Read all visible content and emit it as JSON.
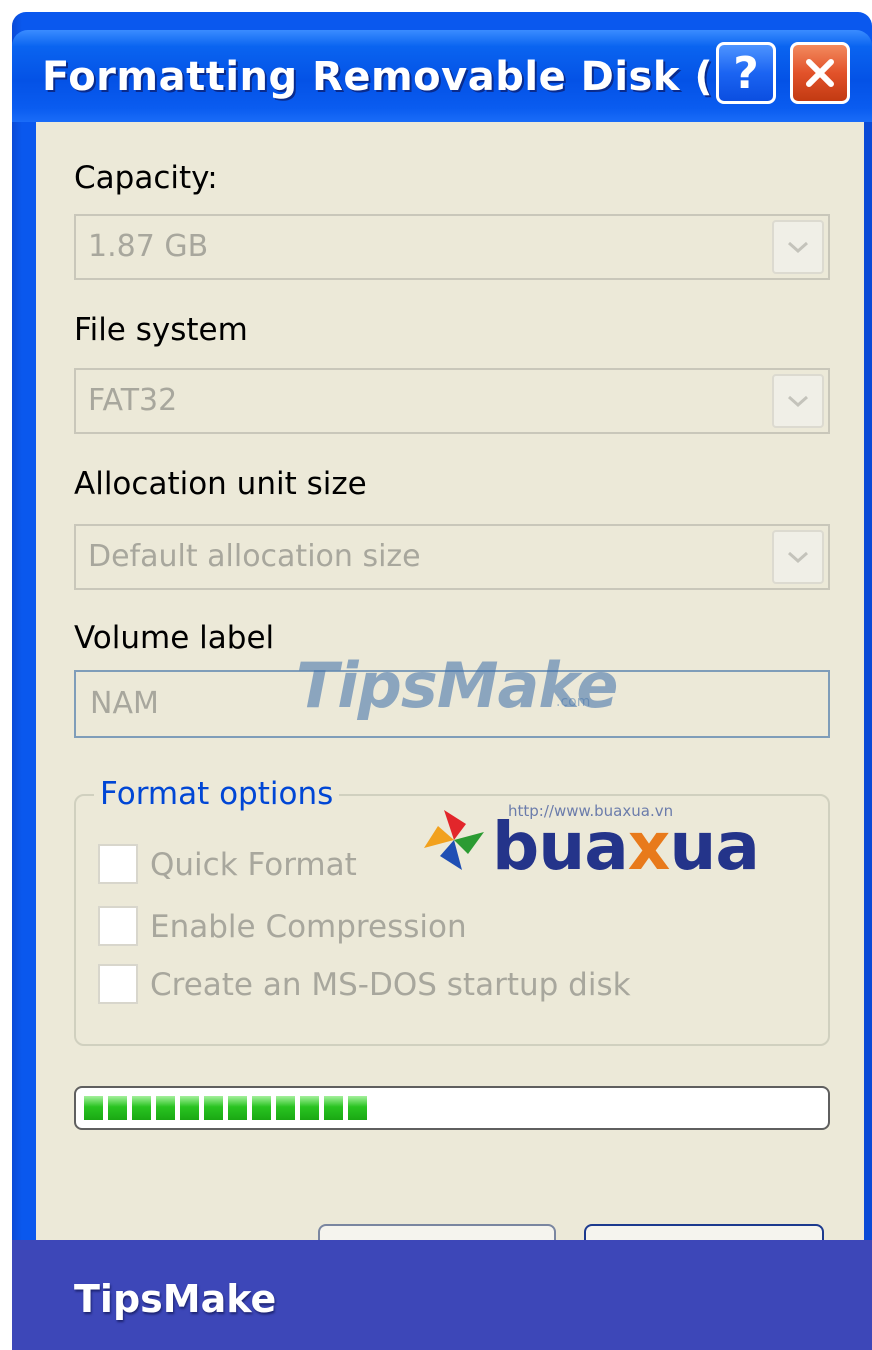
{
  "window": {
    "title": "Formatting Removable Disk (F:)",
    "help_label": "?",
    "close_icon": "close-icon"
  },
  "capacity": {
    "label": "Capacity:",
    "value": "1.87 GB"
  },
  "file_system": {
    "label": "File system",
    "value": "FAT32"
  },
  "allocation": {
    "label": "Allocation unit size",
    "value": "Default allocation size"
  },
  "volume": {
    "label": "Volume label",
    "value": "NAM"
  },
  "format_options": {
    "legend": "Format options",
    "options": [
      {
        "label": "Quick Format",
        "checked": false
      },
      {
        "label": "Enable Compression",
        "checked": false
      },
      {
        "label": "Create an MS-DOS startup disk",
        "checked": false
      }
    ]
  },
  "progress": {
    "fraction": 0.38,
    "color": "#29c421"
  },
  "watermarks": {
    "tipsmake": "TipsMake",
    "tipsmake_suffix": ".com",
    "buaxua_url": "http://www.buaxua.vn",
    "buaxua_word": "buaxua"
  },
  "banner": {
    "text": "TipsMake"
  },
  "colors": {
    "title_bar": "#0a5cf0",
    "client_bg": "#ece9d8",
    "legend_text": "#0046d5",
    "disabled_text": "#a8a79d",
    "banner_bg": "#3d47b8"
  }
}
